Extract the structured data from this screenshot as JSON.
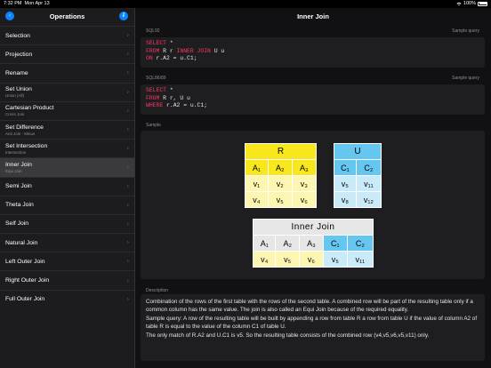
{
  "status": {
    "time": "7:32 PM",
    "date": "Mon Apr 13",
    "battery": "100%"
  },
  "sidebar": {
    "title": "Operations",
    "items": [
      {
        "label": "Selection",
        "sub": ""
      },
      {
        "label": "Projection",
        "sub": ""
      },
      {
        "label": "Rename",
        "sub": ""
      },
      {
        "label": "Set Union",
        "sub": "Union (All)"
      },
      {
        "label": "Cartesian Product",
        "sub": "Cross Join"
      },
      {
        "label": "Set Difference",
        "sub": "Anti Join - Minus"
      },
      {
        "label": "Set Intersection",
        "sub": "Intersection"
      },
      {
        "label": "Inner Join",
        "sub": "Equi Join"
      },
      {
        "label": "Semi Join",
        "sub": ""
      },
      {
        "label": "Theta Join",
        "sub": ""
      },
      {
        "label": "Self Join",
        "sub": ""
      },
      {
        "label": "Natural Join",
        "sub": ""
      },
      {
        "label": "Left Outer Join",
        "sub": ""
      },
      {
        "label": "Right Outer Join",
        "sub": ""
      },
      {
        "label": "Full Outer Join",
        "sub": ""
      }
    ]
  },
  "main": {
    "title": "Inner Join",
    "sql92_label": "SQL92",
    "sql86_label": "SQL86/89",
    "sample_query_label": "Sample query",
    "sample_label": "Sample",
    "description_label": "Description",
    "sql92": {
      "l1a": "SELECT",
      "l1b": " *",
      "l2a": "FROM",
      "l2b": " R r ",
      "l2c": "INNER JOIN",
      "l2d": " U u",
      "l3a": "ON",
      "l3b": " r.A2 = u.C1;"
    },
    "sql86": {
      "l1a": "SELECT",
      "l1b": " *",
      "l2a": "FROM",
      "l2b": " R r, U u",
      "l3a": "WHERE",
      "l3b": " r.A2 = u.C1;"
    },
    "table_r": {
      "name": "R",
      "headers": [
        "A₁",
        "A₂",
        "A₃"
      ],
      "rows": [
        [
          "v₁",
          "v₂",
          "v₃"
        ],
        [
          "v₄",
          "v₅",
          "v₆"
        ]
      ]
    },
    "table_u": {
      "name": "U",
      "headers": [
        "C₁",
        "C₂"
      ],
      "rows": [
        [
          "v₅",
          "v₁₁"
        ],
        [
          "v₈",
          "v₁₂"
        ]
      ]
    },
    "table_join": {
      "name": "Inner Join",
      "headers": [
        "A₁",
        "A₂",
        "A₃",
        "C₁",
        "C₂"
      ],
      "row": [
        "v₄",
        "v₅",
        "v₆",
        "v₅",
        "v₁₁"
      ]
    },
    "description": [
      "Combination of the rows of the first table with the rows of the second table. A combined row will be part of the resulting table only if a common column has the same value. The join is also called an Equi Join because of the required equality.",
      "Sample query: A row of the resulting table will be built by appending a row from table R a row from table U if the value of column A2 of table R is equal to the value of the column C1 of table U.",
      "The only match of R.A2 and U.C1 is v5. So the resulting table consists of the combined row (v4,v5,v6,v5,v11) only."
    ]
  },
  "colors": {
    "accent": "#0a84ff",
    "keyword": "#ff375f",
    "table_r": "#f7e71c",
    "table_r_light": "#fdf6b0",
    "table_u": "#65c7f0",
    "table_u_light": "#c9ebf9",
    "join_head": "#e6e6e6"
  }
}
